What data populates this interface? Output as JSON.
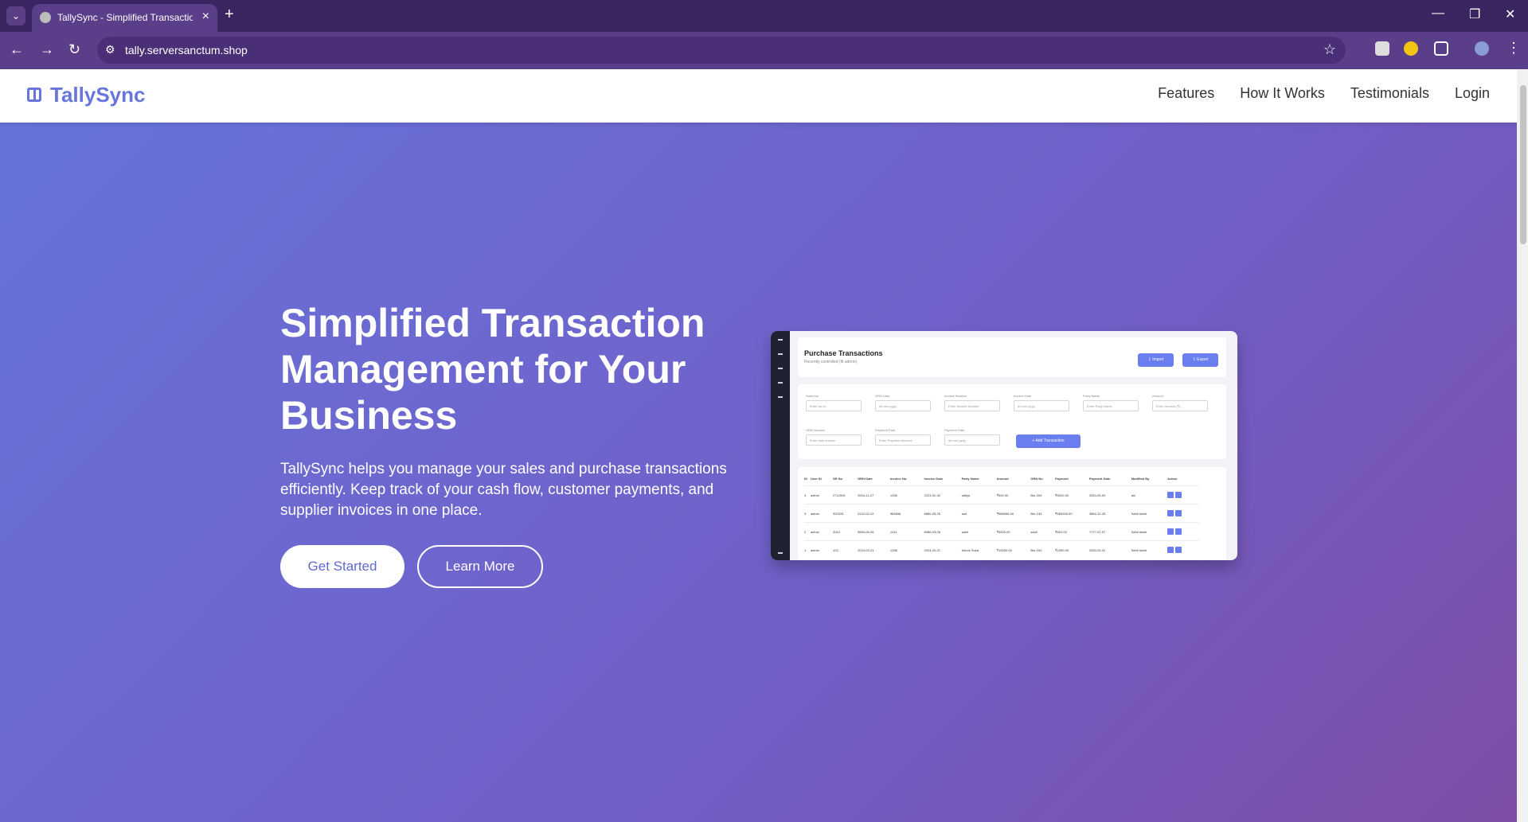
{
  "browser": {
    "tab_title": "TallySync - Simplified Transactio",
    "url": "tally.serversanctum.shop",
    "icons": [
      "tab-search-icon",
      "favicon-icon",
      "close-icon",
      "new-tab-icon",
      "minimize-icon",
      "restore-icon",
      "window-close-icon",
      "back-icon",
      "forward-icon",
      "reload-icon",
      "site-info-icon",
      "bookmark-star-icon",
      "extension-icon",
      "profile-icon",
      "menu-icon"
    ]
  },
  "site": {
    "logo": "TallySync",
    "nav": [
      "Features",
      "How It Works",
      "Testimonials",
      "Login"
    ]
  },
  "hero": {
    "title": "Simplified Transaction Management for Your Business",
    "text": "TallySync helps you manage your sales and purchase transactions efficiently. Keep track of your cash flow, customer payments, and supplier invoices in one place.",
    "primary_button": "Get Started",
    "secondary_button": "Learn More"
  },
  "mockup": {
    "heading": "Purchase Transactions",
    "subheading": "Recently controlled (fit admin)",
    "import": "⇩ Import",
    "export": "⇧ Export",
    "fields": [
      {
        "label": "Sales No",
        "value": "Enter sa no"
      },
      {
        "label": "GRN Date",
        "value": "dd-mm-yyyy"
      },
      {
        "label": "Invoice Number",
        "value": "Enter Invoice Number"
      },
      {
        "label": "Invoice Date",
        "value": "dd-mm-yyyy"
      },
      {
        "label": "Party Name",
        "value": "Enter Party Name"
      },
      {
        "label": "Amount",
        "value": "Enter Amount (₹)"
      },
      {
        "label": "GRN Number",
        "value": "Enter sale number"
      },
      {
        "label": "Payment Paid",
        "value": "Enter Payment Amount"
      },
      {
        "label": "Payment Date",
        "value": "dd-mm-yyyy"
      }
    ],
    "add_button": "+ Add Transaction",
    "headers": [
      "ID",
      "User ID",
      "SR No",
      "GRN Date",
      "Invoice No.",
      "Invoice Date",
      "Party Name",
      "Amount",
      "GRN No",
      "Payment",
      "Payment Date",
      "Modified By",
      "Action"
    ],
    "rows": [
      [
        "4",
        "admin",
        "2712004",
        "2004-11-27",
        "1256",
        "2223-02-32",
        "aditya",
        "₹500.00",
        "Bsr-204",
        "₹5022.00",
        "3333-09-09",
        "ani",
        ""
      ],
      [
        "3",
        "admin",
        "333333",
        "2222-02-22",
        "565656",
        "8880-05-25",
        "asd",
        "₹565656.00",
        "Bsr-233",
        "₹565353.00",
        "3664-12-25",
        "Sahil doshi",
        ""
      ],
      [
        "2",
        "admin",
        "2010",
        "5555-05-05",
        "1411",
        "8080-03-08",
        "sahil",
        "₹5000.00",
        "sahil",
        "₹622.00",
        "7777-07-07",
        "Sahil doshi",
        ""
      ],
      [
        "1",
        "admin",
        "123",
        "2024-03-21",
        "1256",
        "2024-03-21",
        "Ashok Soka",
        "₹10000.00",
        "Bsr-204",
        "₹1000.00",
        "2025-03-31",
        "Sahil doshi",
        ""
      ]
    ]
  }
}
